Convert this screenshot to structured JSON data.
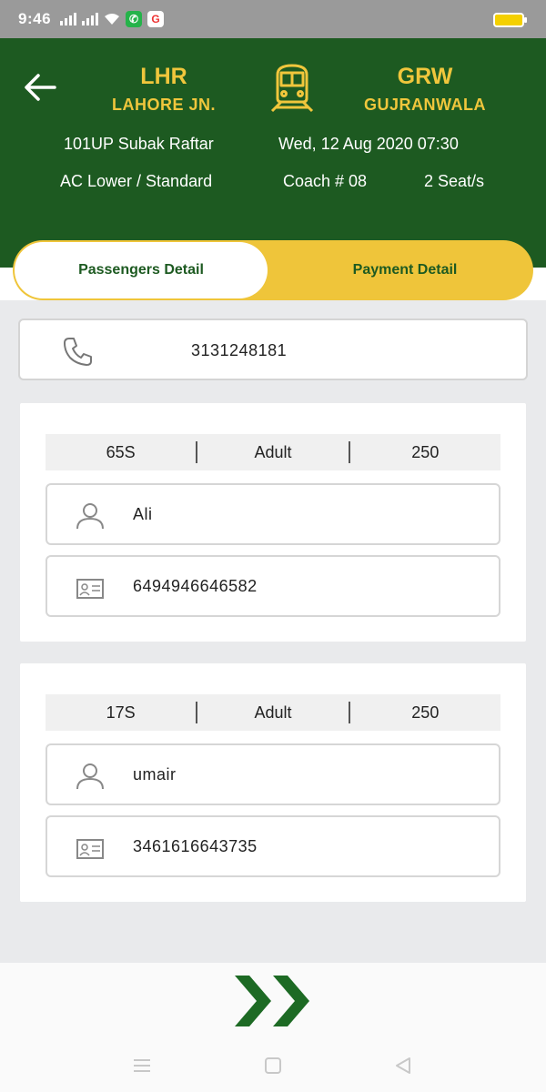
{
  "status_bar": {
    "time": "9:46",
    "icons": [
      "signal-icon",
      "signal-icon",
      "wifi-icon",
      "whatsapp-icon",
      "google-icon",
      "battery-icon"
    ]
  },
  "journey": {
    "from": {
      "code": "LHR",
      "name": "LAHORE JN."
    },
    "to": {
      "code": "GRW",
      "name": "GUJRANWALA"
    },
    "train": "101UP Subak Raftar",
    "datetime": "Wed, 12 Aug 2020 07:30",
    "class": "AC Lower / Standard",
    "coach": "Coach # 08",
    "seats": "2 Seat/s"
  },
  "tabs": {
    "active": "Passengers Detail",
    "inactive": "Payment Detail"
  },
  "contact": {
    "phone": "3131248181"
  },
  "passengers": [
    {
      "seat": "65S",
      "type": "Adult",
      "fare": "250",
      "name": "Ali",
      "id_number": "6494946646582"
    },
    {
      "seat": "17S",
      "type": "Adult",
      "fare": "250",
      "name": "umair",
      "id_number": "3461616643735"
    }
  ],
  "colors": {
    "header_green": "#1d5a21",
    "accent_yellow": "#efc53a",
    "station_text": "#f0c63c",
    "page_bg": "#e9eaec"
  }
}
